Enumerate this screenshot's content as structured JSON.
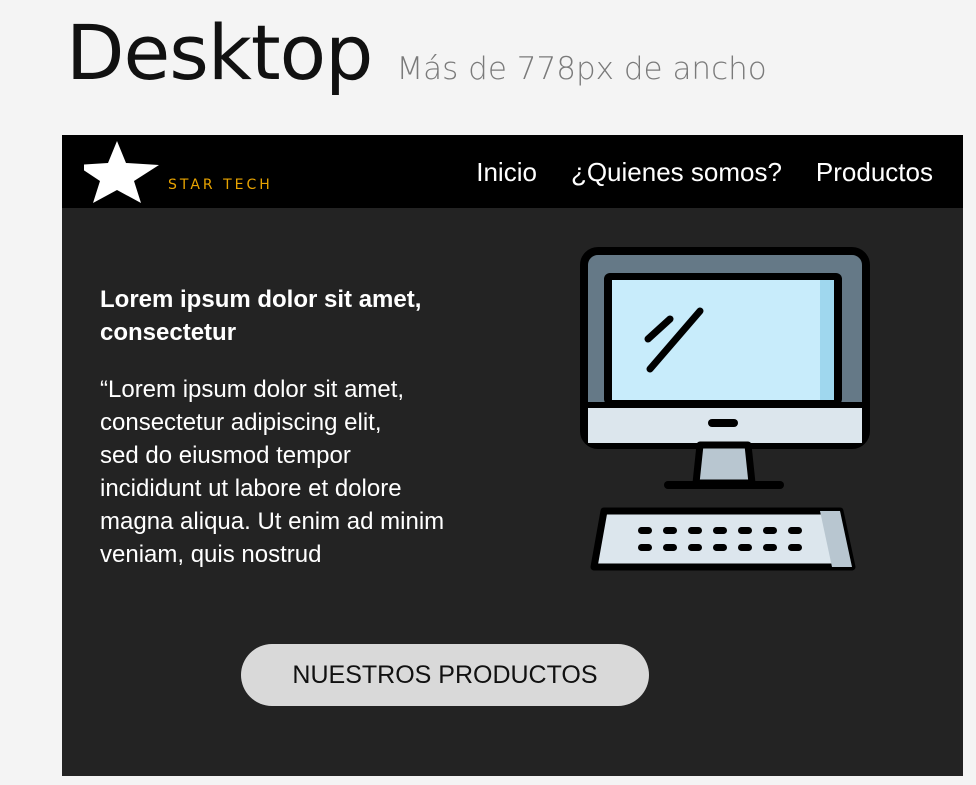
{
  "heading": {
    "title": "Desktop",
    "subtitle": "Más de 778px de ancho"
  },
  "navbar": {
    "logo_text": "STAR TECH",
    "links": [
      "Inicio",
      "¿Quienes somos?",
      "Productos"
    ]
  },
  "content": {
    "title": "Lorem ipsum dolor sit amet, consectetur",
    "body": "“Lorem ipsum dolor sit amet,\nconsectetur adipiscing elit,\nsed do eiusmod tempor\nincididunt ut labore et dolore\nmagna aliqua. Ut enim ad minim\nveniam, quis nostrud",
    "button_label": "NUESTROS PRODUCTOS"
  },
  "illustration": {
    "icon": "desktop-computer-icon"
  },
  "colors": {
    "page_bg": "#f4f4f4",
    "frame_bg": "#232323",
    "navbar_bg": "#000000",
    "logo_text": "#e8a300",
    "button_bg": "#d9d9d9",
    "screen": "#c8ecfb",
    "monitor_frame": "#657987"
  }
}
